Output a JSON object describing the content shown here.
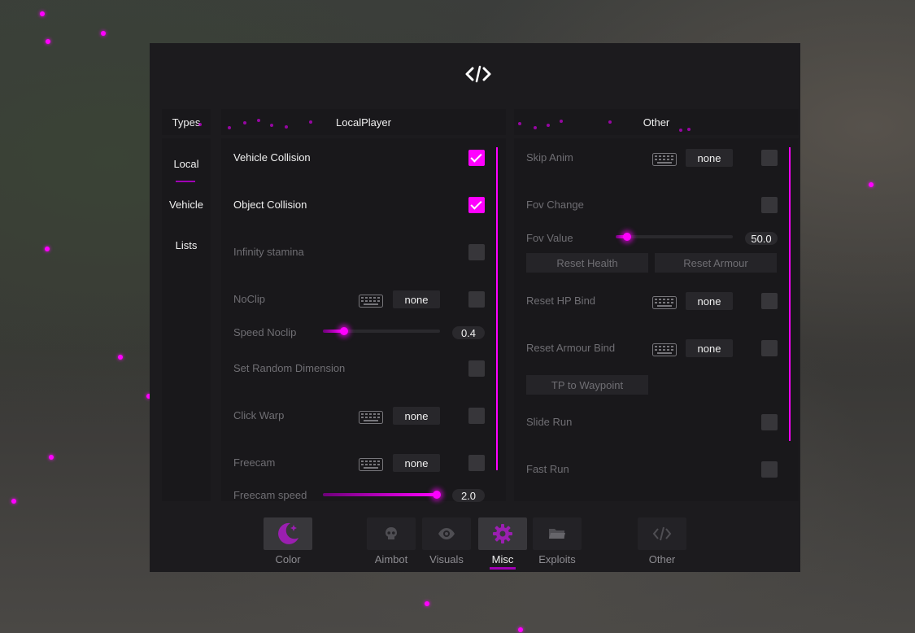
{
  "colors": {
    "accent": "#ff00ff",
    "panel": "#1c1b1e",
    "section": "#19181b"
  },
  "logo_icon": "code-brackets-icon",
  "types": {
    "title": "Types",
    "items": [
      {
        "label": "Local",
        "selected": true
      },
      {
        "label": "Vehicle",
        "selected": false
      },
      {
        "label": "Lists",
        "selected": false
      }
    ]
  },
  "local_player": {
    "title": "LocalPlayer",
    "rows": [
      {
        "label": "Vehicle Collision",
        "checked": true
      },
      {
        "label": "Object Collision",
        "checked": true
      },
      {
        "label": "Infinity stamina",
        "checked": false
      },
      {
        "label": "NoClip",
        "bind": "none",
        "checked": false
      },
      {
        "label": "Speed Noclip",
        "value": "0.4",
        "fraction": 0.18
      },
      {
        "label": "Set Random Dimension",
        "checked": false
      },
      {
        "label": "Click Warp",
        "bind": "none",
        "checked": false
      },
      {
        "label": "Freecam",
        "bind": "none",
        "checked": false
      },
      {
        "label": "Freecam speed",
        "value": "2.0",
        "fraction": 0.97
      }
    ]
  },
  "other": {
    "title": "Other",
    "skip_anim": {
      "label": "Skip Anim",
      "bind": "none",
      "checked": false
    },
    "fov_change": {
      "label": "Fov Change",
      "checked": false
    },
    "fov_value": {
      "label": "Fov Value",
      "value": "50.0",
      "fraction": 0.1
    },
    "reset_health": "Reset Health",
    "reset_armour": "Reset Armour",
    "reset_hp_bind": {
      "label": "Reset HP Bind",
      "bind": "none",
      "checked": false
    },
    "reset_armour_bind": {
      "label": "Reset Armour Bind",
      "bind": "none",
      "checked": false
    },
    "tp_waypoint": "TP to Waypoint",
    "slide_run": {
      "label": "Slide Run",
      "checked": false
    },
    "fast_run": {
      "label": "Fast Run",
      "checked": false
    }
  },
  "nav": [
    {
      "label": "Color",
      "icon": "moon-icon",
      "active": false
    },
    {
      "label": "Aimbot",
      "icon": "skull-icon",
      "active": false
    },
    {
      "label": "Visuals",
      "icon": "eye-icon",
      "active": false
    },
    {
      "label": "Misc",
      "icon": "gear-icon",
      "active": true
    },
    {
      "label": "Exploits",
      "icon": "folder-icon",
      "active": false
    },
    {
      "label": "Other",
      "icon": "code-icon",
      "active": false
    }
  ]
}
